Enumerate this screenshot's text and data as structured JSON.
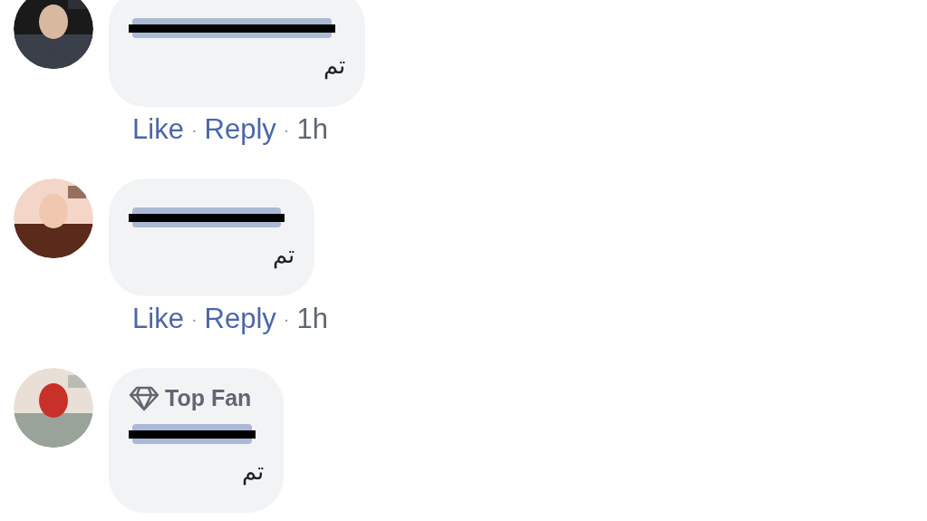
{
  "comments": [
    {
      "name_redacted": true,
      "text": "تم",
      "actions": [
        {
          "kind": "link",
          "label": "Like"
        },
        {
          "kind": "link",
          "label": "Reply"
        },
        {
          "kind": "time",
          "label": "1h"
        }
      ],
      "separator": "·"
    },
    {
      "name_redacted": true,
      "text": "تم",
      "actions": [
        {
          "kind": "link",
          "label": "Like"
        },
        {
          "kind": "link",
          "label": "Reply"
        },
        {
          "kind": "time",
          "label": "1h"
        }
      ],
      "separator": "·"
    },
    {
      "badge": "Top Fan",
      "name_redacted": true,
      "text": "تم"
    }
  ]
}
